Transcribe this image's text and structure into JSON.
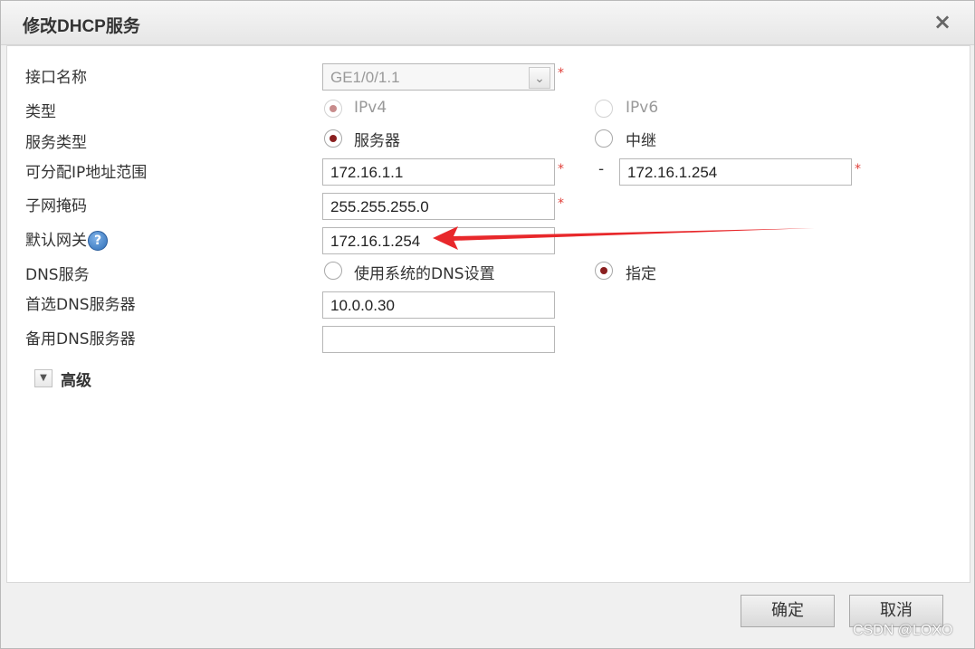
{
  "dialog": {
    "title": "修改DHCP服务",
    "close_label": "×"
  },
  "form": {
    "interface": {
      "label": "接口名称",
      "value": "GE1/0/1.1",
      "required": "*"
    },
    "type": {
      "label": "类型",
      "option1": "IPv4",
      "option2": "IPv6",
      "selected": "IPv4"
    },
    "service_type": {
      "label": "服务类型",
      "option1": "服务器",
      "option2": "中继",
      "selected": "服务器"
    },
    "ip_range": {
      "label": "可分配IP地址范围",
      "start": "172.16.1.1",
      "separator": "-",
      "end": "172.16.1.254",
      "required": "*"
    },
    "subnet_mask": {
      "label": "子网掩码",
      "value": "255.255.255.0",
      "required": "*"
    },
    "gateway": {
      "label": "默认网关",
      "help": "?",
      "value": "172.16.1.254"
    },
    "dns_service": {
      "label": "DNS服务",
      "option1": "使用系统的DNS设置",
      "option2": "指定",
      "selected": "指定"
    },
    "primary_dns": {
      "label": "首选DNS服务器",
      "value": "10.0.0.30"
    },
    "secondary_dns": {
      "label": "备用DNS服务器",
      "value": ""
    },
    "advanced": {
      "label": "高级",
      "icon": "▼"
    }
  },
  "footer": {
    "ok_label": "确定",
    "cancel_label": "取消"
  },
  "watermark": "CSDN @LOXO",
  "colors": {
    "required": "#e0403a",
    "radio_selected": "#8a1f1f",
    "annotation_arrow": "#e8282b"
  }
}
